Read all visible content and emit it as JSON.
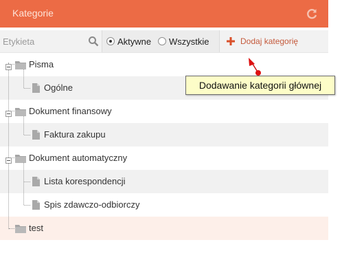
{
  "header": {
    "title": "Kategorie",
    "refresh_icon": "refresh-icon"
  },
  "toolbar": {
    "search_placeholder": "Etykieta",
    "search_value": "",
    "filter": {
      "options": [
        "Aktywne",
        "Wszystkie"
      ],
      "selected": "Aktywne"
    },
    "add_label": "Dodaj kategorię"
  },
  "tooltip": {
    "text": "Dodawanie kategorii głównej"
  },
  "tree": {
    "nodes": [
      {
        "label": "Pisma",
        "type": "folder",
        "level": 0
      },
      {
        "label": "Ogólne",
        "type": "document",
        "level": 1
      },
      {
        "label": "Dokument finansowy",
        "type": "folder",
        "level": 0
      },
      {
        "label": "Faktura zakupu",
        "type": "document",
        "level": 1
      },
      {
        "label": "Dokument automatyczny",
        "type": "folder",
        "level": 0
      },
      {
        "label": "Lista korespondencji",
        "type": "document",
        "level": 1
      },
      {
        "label": "Spis zdawczo-odbiorczy",
        "type": "document",
        "level": 1
      },
      {
        "label": "test",
        "type": "folder",
        "level": 0,
        "selected": true
      }
    ]
  },
  "colors": {
    "header": "#ec6b45",
    "add_accent": "#c45a3c",
    "tooltip_bg": "#fdfdc8",
    "selected_row": "#fdefe9"
  }
}
